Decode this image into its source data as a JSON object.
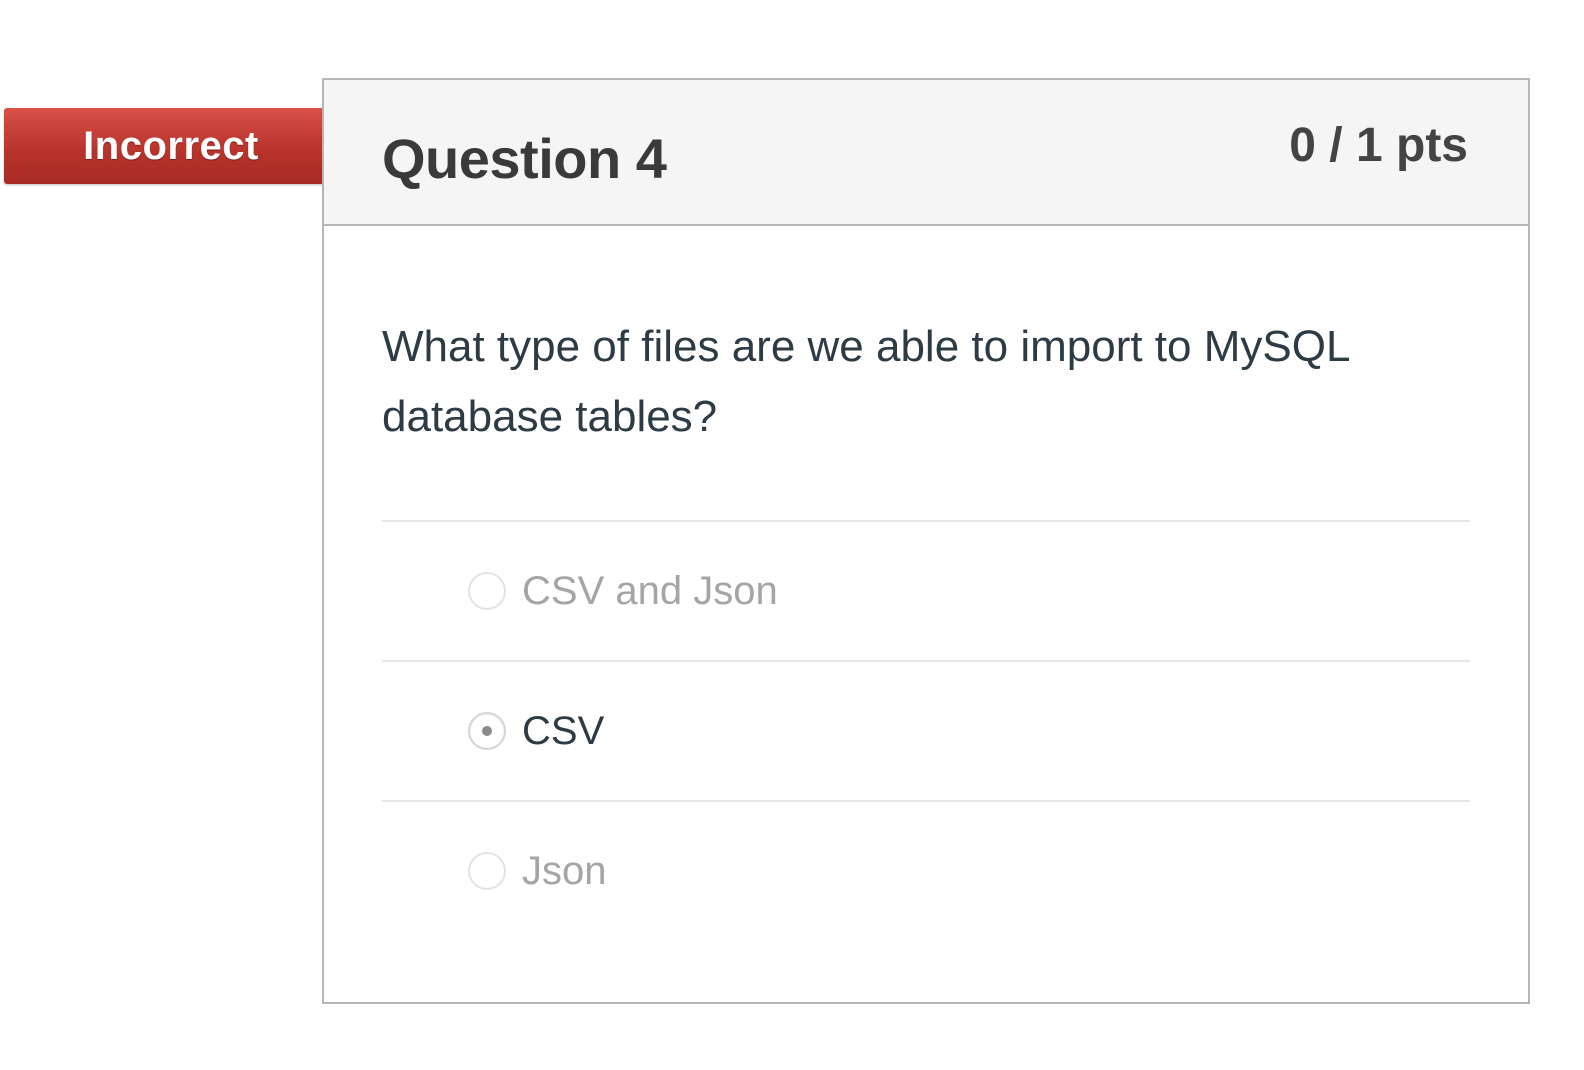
{
  "status_badge": {
    "label": "Incorrect",
    "color": "#c0392f"
  },
  "question": {
    "title": "Question 4",
    "points": "0 / 1 pts",
    "text": "What type of files are we able to import to MySQL database tables?"
  },
  "answers": [
    {
      "label": "CSV and Json",
      "selected": false
    },
    {
      "label": "CSV",
      "selected": true
    },
    {
      "label": "Json",
      "selected": false
    }
  ]
}
